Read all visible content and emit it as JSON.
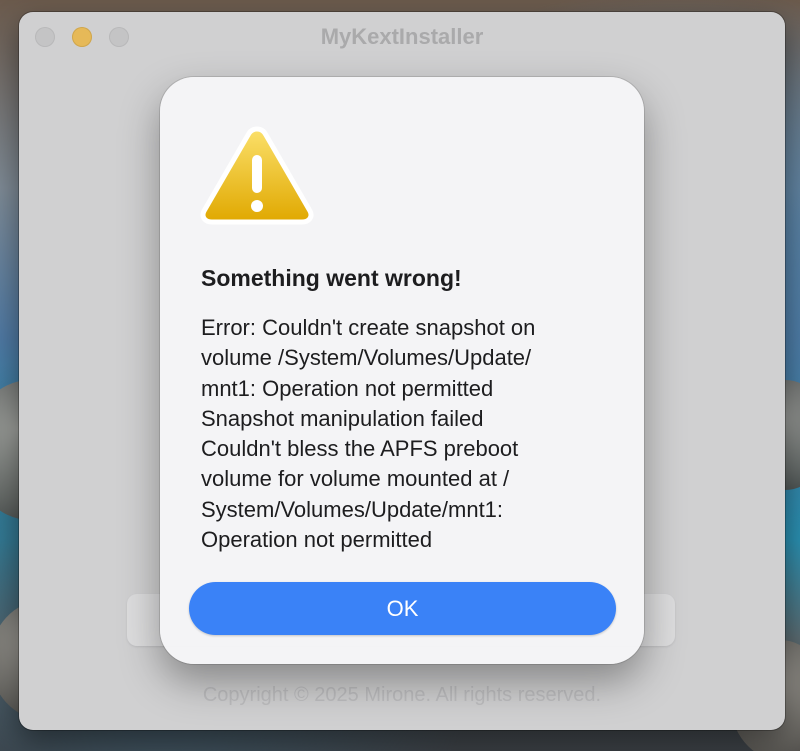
{
  "window": {
    "title": "MyKextInstaller",
    "copyright": "Copyright © 2025 Mirone. All rights reserved."
  },
  "alert": {
    "icon": "warning-triangle-icon",
    "title": "Something went wrong!",
    "message_lines": [
      "Error: Couldn't create snapshot on",
      "volume /System/Volumes/Update/",
      "mnt1: Operation not permitted",
      "Snapshot manipulation failed",
      "Couldn't bless the APFS preboot",
      "volume for volume mounted at /",
      "System/Volumes/Update/mnt1:",
      "Operation not permitted"
    ],
    "ok_label": "OK"
  },
  "colors": {
    "accent": "#3a82f7",
    "warning_yellow": "#f2c21b",
    "minimize_button": "#f5b731"
  }
}
